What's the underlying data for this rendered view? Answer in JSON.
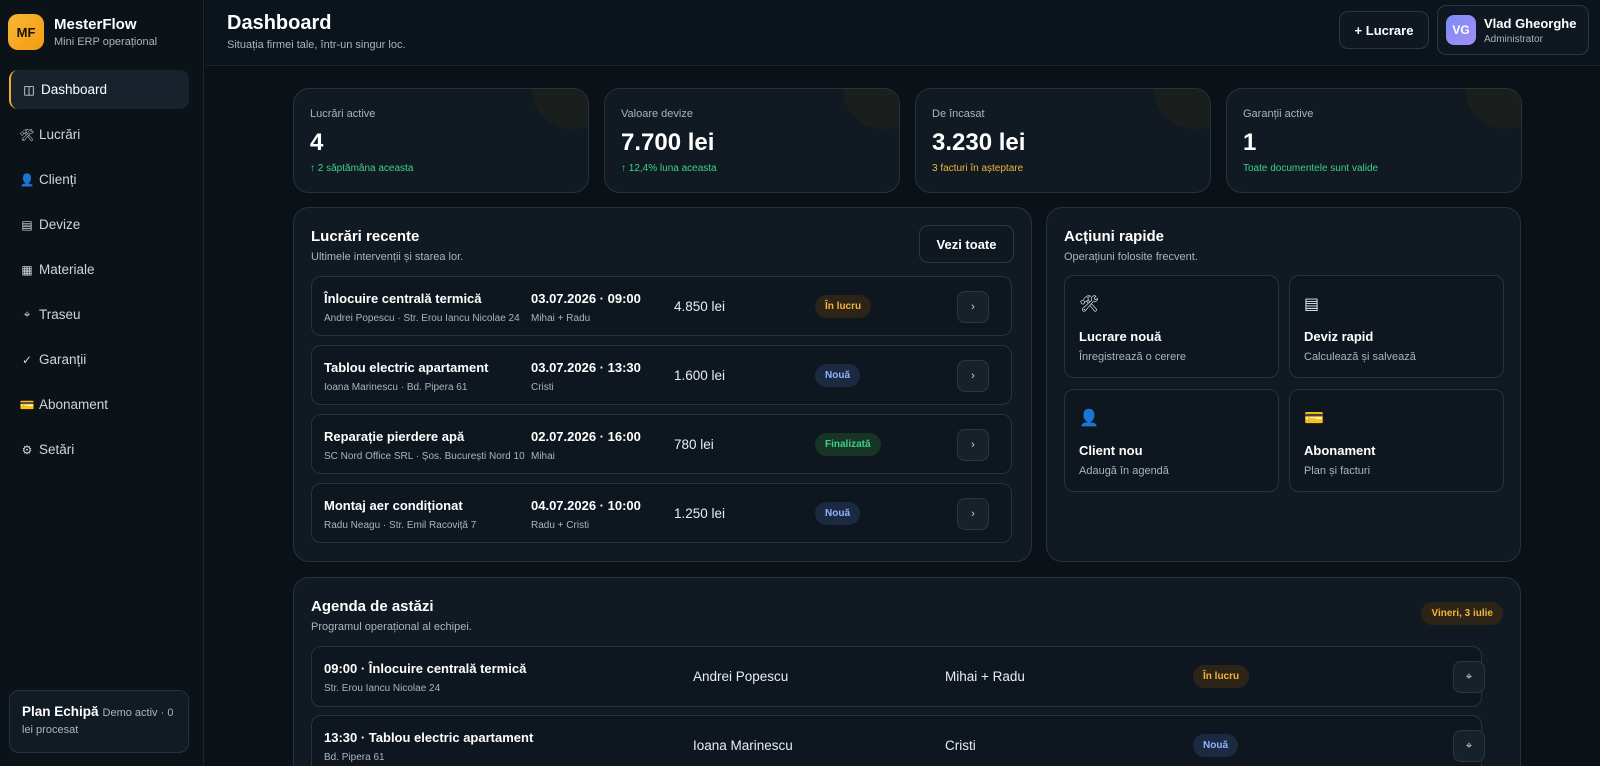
{
  "brand": {
    "logo": "MF",
    "name": "MesterFlow",
    "subtitle": "Mini ERP operațional"
  },
  "nav": [
    {
      "icon": "◫",
      "label": "Dashboard",
      "active": true
    },
    {
      "icon": "🛠",
      "label": "Lucrări"
    },
    {
      "icon": "👤",
      "label": "Clienți"
    },
    {
      "icon": "▤",
      "label": "Devize"
    },
    {
      "icon": "▦",
      "label": "Materiale"
    },
    {
      "icon": "⌖",
      "label": "Traseu"
    },
    {
      "icon": "✓",
      "label": "Garanții"
    },
    {
      "icon": "💳",
      "label": "Abonament"
    },
    {
      "icon": "⚙",
      "label": "Setări"
    }
  ],
  "plan": {
    "name": "Plan Echipă",
    "details": "Demo activ · 0 lei procesat"
  },
  "header": {
    "title": "Dashboard",
    "subtitle": "Situația firmei tale, într-un singur loc.",
    "new_button": "+ Lucrare",
    "user": {
      "initials": "VG",
      "name": "Vlad Gheorghe",
      "role": "Administrator"
    }
  },
  "stats": [
    {
      "label": "Lucrări active",
      "value": "4",
      "note": "↑ 2 săptămâna aceasta",
      "note_color": "#3ed08a"
    },
    {
      "label": "Valoare devize",
      "value": "7.700 lei",
      "note": "↑ 12,4% luna aceasta",
      "note_color": "#3ed08a"
    },
    {
      "label": "De încasat",
      "value": "3.230 lei",
      "note": "3 facturi în așteptare",
      "note_color": "#f0b43a"
    },
    {
      "label": "Garanții active",
      "value": "1",
      "note": "Toate documentele sunt valide",
      "note_color": "#3ed08a"
    }
  ],
  "recent": {
    "title": "Lucrări recente",
    "subtitle": "Ultimele intervenții și starea lor.",
    "see_all": "Vezi toate",
    "rows": [
      {
        "title": "Înlocuire centrală termică",
        "address": "Andrei Popescu · Str. Erou Iancu Nicolae 24",
        "date": "03.07.2026 · 09:00",
        "team": "Mihai + Radu",
        "price": "4.850 lei",
        "status": "În lucru",
        "status_type": "work"
      },
      {
        "title": "Tablou electric apartament",
        "address": "Ioana Marinescu · Bd. Pipera 61",
        "date": "03.07.2026 · 13:30",
        "team": "Cristi",
        "price": "1.600 lei",
        "status": "Nouă",
        "status_type": "new"
      },
      {
        "title": "Reparație pierdere apă",
        "address": "SC Nord Office SRL · Șos. București Nord 10",
        "date": "02.07.2026 · 16:00",
        "team": "Mihai",
        "price": "780 lei",
        "status": "Finalizată",
        "status_type": "done"
      },
      {
        "title": "Montaj aer condiționat",
        "address": "Radu Neagu · Str. Emil Racoviță 7",
        "date": "04.07.2026 · 10:00",
        "team": "Radu + Cristi",
        "price": "1.250 lei",
        "status": "Nouă",
        "status_type": "new"
      }
    ],
    "arrow": "›"
  },
  "quick": {
    "title": "Acțiuni rapide",
    "subtitle": "Operațiuni folosite frecvent.",
    "tiles": [
      {
        "icon": "🛠",
        "title": "Lucrare nouă",
        "sub": "Înregistrează o cerere"
      },
      {
        "icon": "▤",
        "title": "Deviz rapid",
        "sub": "Calculează și salvează"
      },
      {
        "icon": "👤",
        "title": "Client nou",
        "sub": "Adaugă în agendă"
      },
      {
        "icon": "💳",
        "title": "Abonament",
        "sub": "Plan și facturi"
      }
    ]
  },
  "agenda": {
    "title": "Agenda de astăzi",
    "subtitle": "Programul operațional al echipei.",
    "date_badge": "Vineri, 3 iulie",
    "rows": [
      {
        "title": "09:00 · Înlocuire centrală termică",
        "address": "Str. Erou Iancu Nicolae 24",
        "client": "Andrei Popescu",
        "team": "Mihai + Radu",
        "status": "În lucru",
        "status_type": "work"
      },
      {
        "title": "13:30 · Tablou electric apartament",
        "address": "Bd. Pipera 61",
        "client": "Ioana Marinescu",
        "team": "Cristi",
        "status": "Nouă",
        "status_type": "new"
      }
    ],
    "arrow": "⌖"
  }
}
